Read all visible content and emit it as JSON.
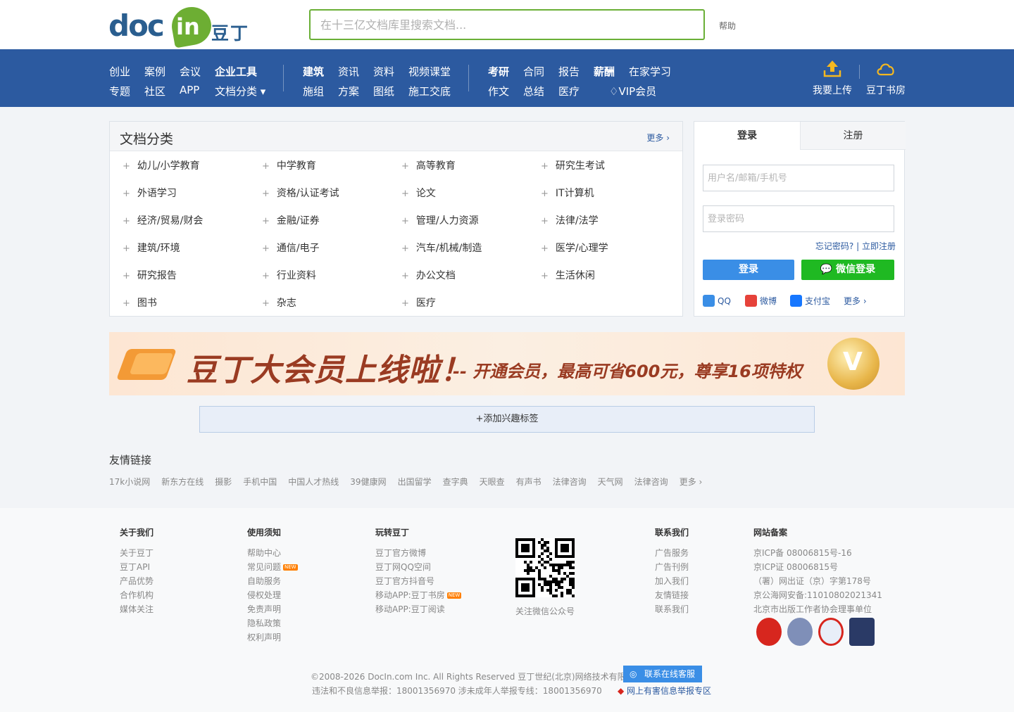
{
  "header": {
    "logo_doc": "doc",
    "logo_in": "in",
    "logo_cn": "豆丁",
    "search_placeholder": "在十三亿文档库里搜索文档...",
    "help": "帮助"
  },
  "nav": {
    "group1_row1": [
      "创业",
      "案例",
      "会议",
      "企业工具"
    ],
    "group1_row2": [
      "专题",
      "社区",
      "APP",
      "文档分类 ▾"
    ],
    "group2_row1": [
      "建筑",
      "资讯",
      "资料",
      "视频课堂"
    ],
    "group2_row2": [
      "施组",
      "方案",
      "图纸",
      "施工交底"
    ],
    "group3_row1": [
      "考研",
      "合同",
      "报告",
      "薪酬",
      "在家学习"
    ],
    "group3_row2": [
      "作文",
      "总结",
      "医疗",
      "VIP会员"
    ],
    "upload": "我要上传",
    "bookroom": "豆丁书房"
  },
  "category": {
    "title": "文档分类",
    "more": "更多 ›",
    "rows": [
      [
        "幼儿/小学教育",
        "中学教育",
        "高等教育",
        "研究生考试"
      ],
      [
        "外语学习",
        "资格/认证考试",
        "论文",
        "IT计算机"
      ],
      [
        "经济/贸易/财会",
        "金融/证券",
        "管理/人力资源",
        "法律/法学"
      ],
      [
        "建筑/环境",
        "通信/电子",
        "汽车/机械/制造",
        "医学/心理学"
      ],
      [
        "研究报告",
        "行业资料",
        "办公文档",
        "生活休闲"
      ],
      [
        "图书",
        "杂志",
        "医疗",
        ""
      ]
    ]
  },
  "login": {
    "tab_login": "登录",
    "tab_register": "注册",
    "username_placeholder": "用户名/邮箱/手机号",
    "password_placeholder": "登录密码",
    "forgot": "忘记密码?",
    "register_now": "立即注册",
    "login_button": "登录",
    "wechat_button": "微信登录",
    "social_qq": "QQ",
    "social_weibo": "微博",
    "social_alipay": "支付宝",
    "social_more": "更多 ›"
  },
  "banner": {
    "headline": "豆丁大会员上线啦！",
    "sub": "-- 开通会员，最高可省600元，尊享16项特权"
  },
  "interest": "+添加兴趣标签",
  "friends": {
    "title": "友情链接",
    "links": [
      "17k小说网",
      "新东方在线",
      "摄影",
      "手机中国",
      "中国人才热线",
      "39健康网",
      "出国留学",
      "查字典",
      "天眼查",
      "有声书",
      "法律咨询",
      "天气网",
      "法律咨询",
      "更多 ›"
    ]
  },
  "footer": {
    "about": {
      "title": "关于我们",
      "items": [
        "关于豆丁",
        "豆丁API",
        "产品优势",
        "合作机构",
        "媒体关注"
      ]
    },
    "usage": {
      "title": "使用须知",
      "items": [
        "帮助中心",
        "常见问题",
        "自助服务",
        "侵权处理",
        "免责声明",
        "隐私政策",
        "权利声明"
      ]
    },
    "play": {
      "title": "玩转豆丁",
      "items": [
        "豆丁官方微博",
        "豆丁网QQ空间",
        "豆丁官方抖音号",
        "移动APP:豆丁书房",
        "移动APP:豆丁阅读"
      ]
    },
    "new_badge": "NEW",
    "qr_caption": "关注微信公众号",
    "contact": {
      "title": "联系我们",
      "items": [
        "广告服务",
        "广告刊例",
        "加入我们",
        "友情链接",
        "联系我们"
      ]
    },
    "record": {
      "title": "网站备案",
      "items": [
        "京ICP备 08006815号-16",
        "京ICP证 08006815号",
        "（署）网出证（京）字第178号",
        "京公海网安备:11010802021341",
        "北京市出版工作者协会理事单位"
      ]
    },
    "copyright": "©2008-2026 DocIn.com Inc. All Rights Reserved 豆丁世纪(北京)网络技术有限公司",
    "report_line": "违法和不良信息举报：18001356970  涉未成年人举报专线：18001356970",
    "service": "联系在线客服",
    "harmful": "网上有害信息举报专区"
  }
}
